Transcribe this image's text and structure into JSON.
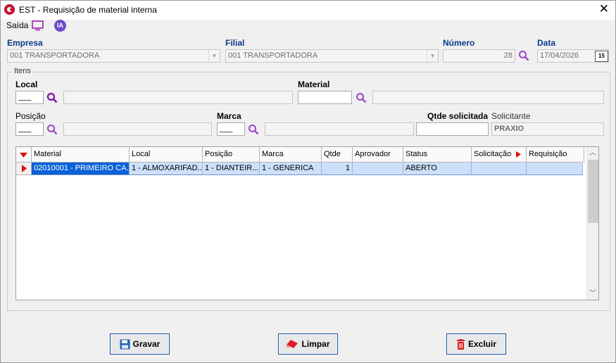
{
  "window": {
    "title": "EST - Requisição de material interna",
    "close_glyph": "✕"
  },
  "toolbar": {
    "saida_label": "Saída",
    "ia_label": "IA"
  },
  "header": {
    "empresa_label": "Empresa",
    "empresa_value": "001 TRANSPORTADORA",
    "filial_label": "Filial",
    "filial_value": "001 TRANSPORTADORA",
    "numero_label": "Número",
    "numero_value": "28",
    "data_label": "Data",
    "data_value": "17/04/2026",
    "cal_label": "15"
  },
  "itens": {
    "group_label": "Itens",
    "local_label": "Local",
    "local_value": "___",
    "material_label": "Material",
    "posicao_label": "Posição",
    "posicao_value": "___",
    "marca_label": "Marca",
    "marca_value": "___",
    "qtde_label": "Qtde solicitada",
    "solicitante_label": "Solicitante",
    "solicitante_value": "PRAXIO"
  },
  "grid": {
    "columns": [
      "Material",
      "Local",
      "Posição",
      "Marca",
      "Qtde",
      "Aprovador",
      "Status",
      "Solicitação",
      "Requisição"
    ],
    "rows": [
      [
        "02010001 - PRIMEIRO CA...",
        "1 - ALMOXARIFAD...",
        "1 - DIANTEIR...",
        "1 - GENERICA",
        "1",
        "",
        "ABERTO",
        "",
        ""
      ]
    ]
  },
  "buttons": {
    "gravar": "Gravar",
    "limpar": "Limpar",
    "excluir": "Excluir"
  },
  "colors": {
    "accent": "#0a62d6",
    "selection": "#cce0fa",
    "brand_red": "#c8102e",
    "ia_purple": "#6b4cc8"
  }
}
